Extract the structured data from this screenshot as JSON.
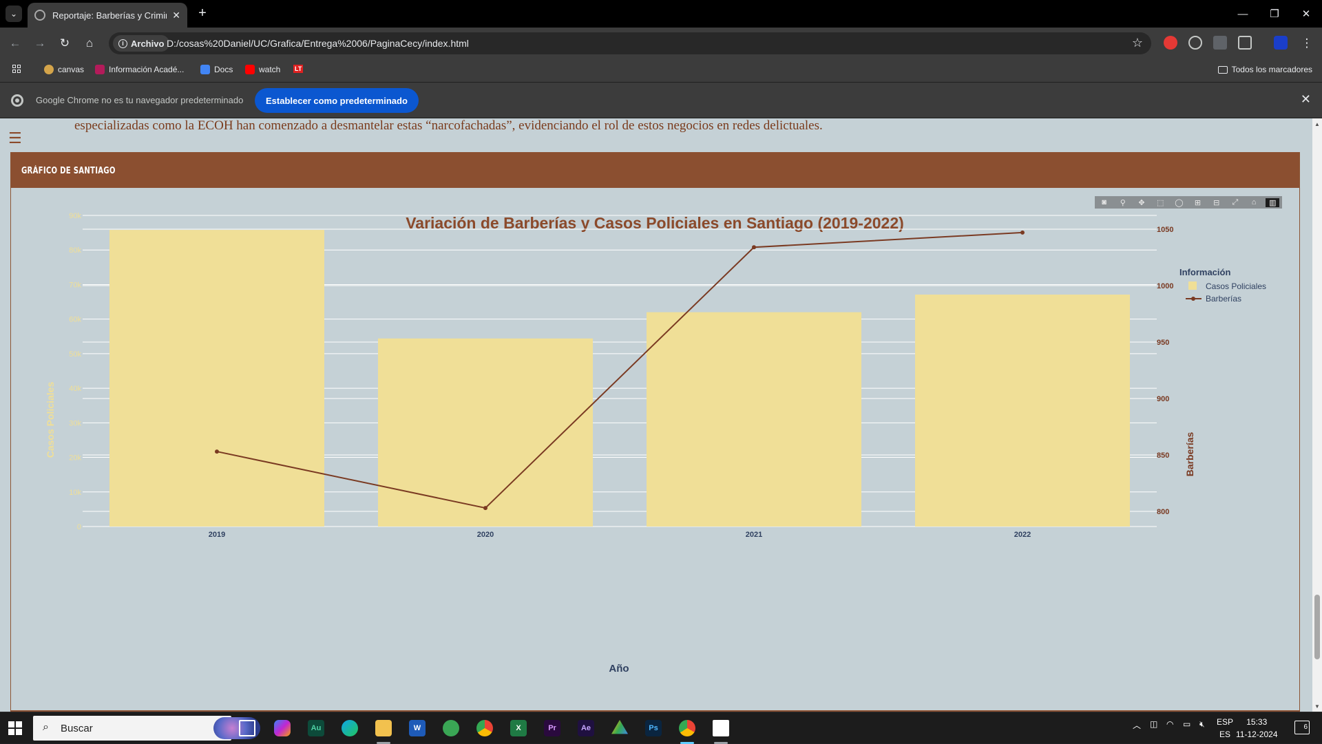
{
  "browser": {
    "tab_title": "Reportaje: Barberías y Criminalid",
    "address_chip": "Archivo",
    "url": "D:/cosas%20Daniel/UC/Grafica/Entrega%2006/PaginaCecy/index.html",
    "bookmarks": [
      "canvas",
      "Información Acadé...",
      "Docs",
      "watch",
      "LT"
    ],
    "all_bookmarks": "Todos los marcadores",
    "infobar_text": "Google Chrome no es tu navegador predeterminado",
    "infobar_button": "Establecer como predeterminado"
  },
  "page": {
    "paragraph": "especializadas como la ECOH han comenzado a desmantelar estas “narcofachadas”, evidenciando el rol de estos negocios en redes delictuales.",
    "card_title": "GRÁFICO DE SANTIAGO"
  },
  "chart_data": {
    "type": "bar",
    "title": "Variación de Barberías y Casos Policiales en Santiago (2019-2022)",
    "xlabel": "Año",
    "categories": [
      "2019",
      "2020",
      "2021",
      "2022"
    ],
    "ylabel": "Casos Policiales",
    "y_ticks": [
      "0",
      "10k",
      "20k",
      "30k",
      "40k",
      "50k",
      "60k",
      "70k",
      "80k",
      "90k"
    ],
    "ylim": [
      0,
      90000
    ],
    "y2label": "Barberías",
    "y2_ticks": [
      "800",
      "850",
      "900",
      "950",
      "1000",
      "1050"
    ],
    "y2lim": [
      785,
      1060
    ],
    "legend_title": "Información",
    "legend_position": "top-right",
    "series": [
      {
        "name": "Casos Policiales",
        "kind": "bar",
        "axis": "left",
        "color": "#f0df97",
        "values": [
          85800,
          54400,
          62000,
          67100
        ]
      },
      {
        "name": "Barberías",
        "kind": "line",
        "axis": "right",
        "color": "#7a3a22",
        "values": [
          853,
          803,
          1034,
          1047
        ]
      }
    ],
    "colors": {
      "title": "#8b4a2b",
      "left_axis": "#f0df97",
      "right_axis": "#7a3a22",
      "x_axis": "#2f4060"
    }
  },
  "taskbar": {
    "search_label": "Buscar",
    "apps": [
      "Au",
      "W",
      "Pr",
      "Ae",
      "Ps"
    ],
    "lang_top": "ESP",
    "lang_bottom": "ES",
    "time": "15:33",
    "date": "11-12-2024",
    "notifications": "6"
  }
}
